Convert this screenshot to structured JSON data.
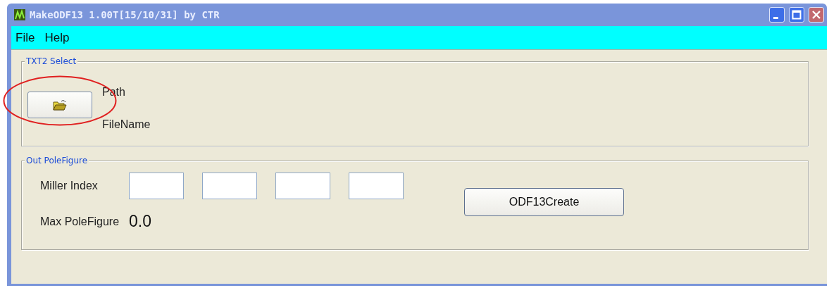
{
  "window": {
    "title": "MakeODF13 1.00T[15/10/31] by CTR"
  },
  "menu": [
    "File",
    "Help"
  ],
  "txt2_select": {
    "legend": "TXT2 Select",
    "path_label": "Path",
    "filename_label": "FileName",
    "highlighted": true
  },
  "out_polefigure": {
    "legend": "Out PoleFigure",
    "miller_label": "Miller Index",
    "miller_fields": [
      {
        "kind": "text"
      },
      {
        "kind": "text"
      },
      {
        "kind": "text"
      },
      {
        "kind": "text"
      }
    ],
    "max_label": "Max PoleFigure",
    "max_value": "0.0",
    "create_button": "ODF13Create"
  }
}
